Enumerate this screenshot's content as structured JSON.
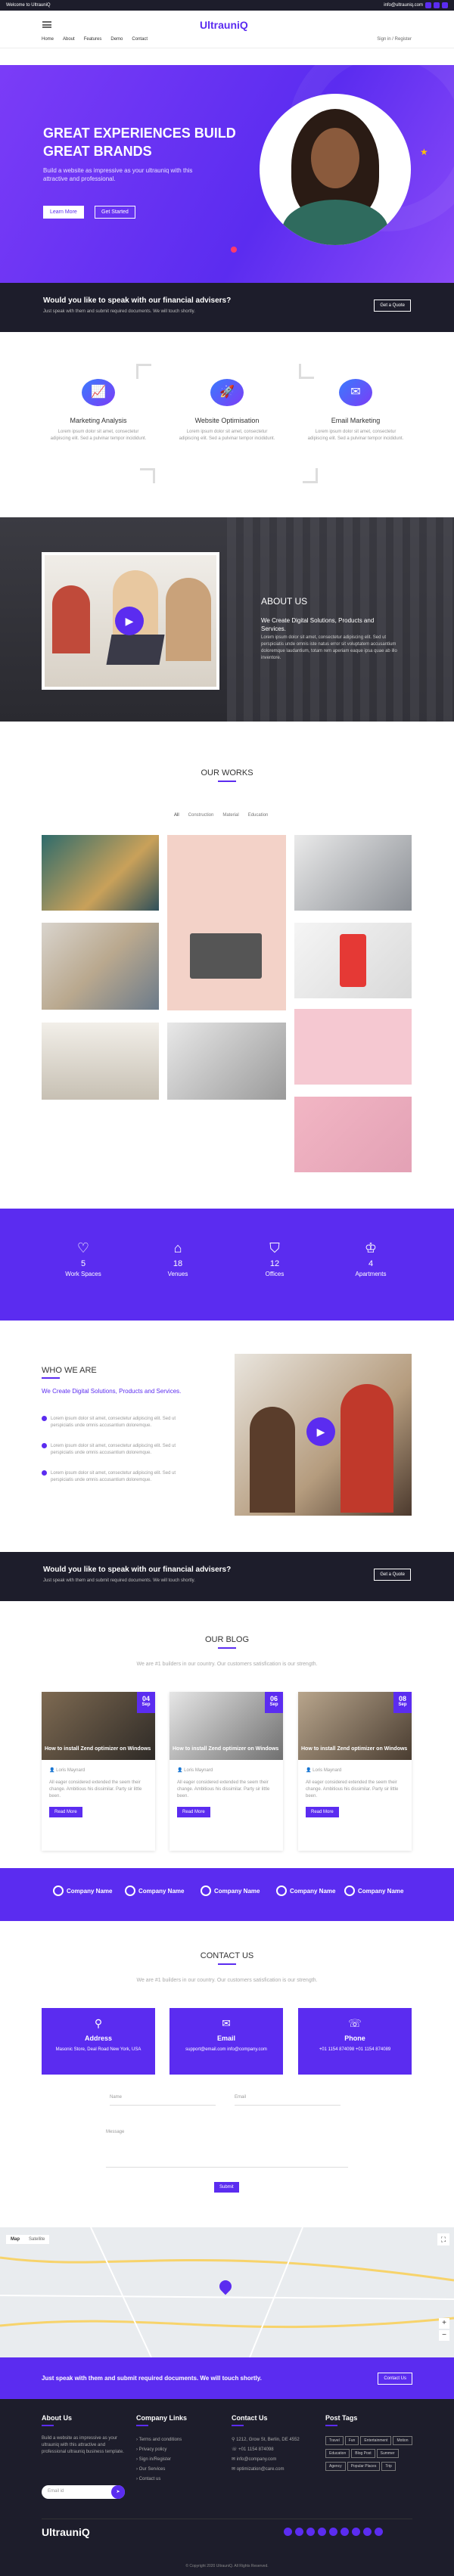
{
  "topbar": {
    "welcome": "Welcome to UltrauniQ",
    "email": "info@ultrauniq.com"
  },
  "header": {
    "logo": "UltrauniQ",
    "signin": "Sign in / Register",
    "nav": [
      "Home",
      "About",
      "Features",
      "Demo",
      "Contact"
    ]
  },
  "hero": {
    "headline": "GREAT EXPERIENCES BUILD GREAT BRANDS",
    "text": "Build a website as impressive as your ultrauniq with this attractive and professional.",
    "btn1": "Learn More",
    "btn2": "Get Started"
  },
  "advisor": {
    "title": "Would you like to speak with our financial advisers?",
    "text": "Just speak with them and submit required documents. We will touch shortly.",
    "btn": "Get a Quote"
  },
  "features": [
    {
      "icon": "📈",
      "title": "Marketing Analysis",
      "text": "Lorem ipsum dolor sit amet, consectetur adipiscing elit. Sed a pulvinar tempor incididunt."
    },
    {
      "icon": "🚀",
      "title": "Website Optimisation",
      "text": "Lorem ipsum dolor sit amet, consectetur adipiscing elit. Sed a pulvinar tempor incididunt."
    },
    {
      "icon": "✉",
      "title": "Email Marketing",
      "text": "Lorem ipsum dolor sit amet, consectetur adipiscing elit. Sed a pulvinar tempor incididunt."
    }
  ],
  "about": {
    "title": "ABOUT US",
    "subtitle": "We Create Digital Solutions, Products and Services.",
    "text": "Lorem ipsum dolor sit amet, consectetur adipiscing elit. Sed ut perspiciatis unde omnis iste natus error sit voluptatem accusantium doloremque laudantium, totam rem aperiam eaque ipsa quae ab illo inventore."
  },
  "works": {
    "title": "OUR WORKS",
    "filters": [
      "All",
      "Construction",
      "Material",
      "Education"
    ]
  },
  "stats": [
    {
      "icon": "♡",
      "num": "5",
      "label": "Work Spaces"
    },
    {
      "icon": "⌂",
      "num": "18",
      "label": "Venues"
    },
    {
      "icon": "⛉",
      "num": "12",
      "label": "Offices"
    },
    {
      "icon": "♔",
      "num": "4",
      "label": "Apartments"
    }
  ],
  "whoweare": {
    "title": "WHO WE ARE",
    "subtitle": "We Create Digital Solutions, Products and Services.",
    "items": [
      "Lorem ipsum dolor sit amet, consectetur adipiscing elit. Sed ut perspiciatis unde omnis accusantium doloremque.",
      "Lorem ipsum dolor sit amet, consectetur adipiscing elit. Sed ut perspiciatis unde omnis accusantium doloremque.",
      "Lorem ipsum dolor sit amet, consectetur adipiscing elit. Sed ut perspiciatis unde omnis accusantium doloremque."
    ]
  },
  "blog": {
    "title": "OUR BLOG",
    "intro": "We are #1 builders in our country. Our customers satisfication is our strength.",
    "posts": [
      {
        "day": "04",
        "month": "Sep",
        "title": "How to install Zend optimizer on Windows",
        "author": "Loris Maynard",
        "text": "All eager considered extended the seem their change. Ambitious his dissimilar. Party sir little been.",
        "btn": "Read More"
      },
      {
        "day": "06",
        "month": "Sep",
        "title": "How to install Zend optimizer on Windows",
        "author": "Loris Maynard",
        "text": "All eager considered extended the seem their change. Ambitious his dissimilar. Party sir little been.",
        "btn": "Read More"
      },
      {
        "day": "08",
        "month": "Sep",
        "title": "How to install Zend optimizer on Windows",
        "author": "Loris Maynard",
        "text": "All eager considered extended the seem their change. Ambitious his dissimilar. Party sir little been.",
        "btn": "Read More"
      }
    ]
  },
  "logos": [
    "Company Name",
    "Company Name",
    "Company Name",
    "Company Name",
    "Company Name"
  ],
  "contact": {
    "title": "CONTACT US",
    "intro": "We are #1 builders in our country. Our customers satisfication is our strength.",
    "boxes": [
      {
        "icon": "⚲",
        "title": "Address",
        "text": "Masonic Store, Deal Road New York, USA"
      },
      {
        "icon": "✉",
        "title": "Email",
        "text": "support@email.com info@company.com"
      },
      {
        "icon": "☏",
        "title": "Phone",
        "text": "+01 1154 874098 +01 1154 874089"
      }
    ],
    "name": "Name",
    "email": "Email",
    "message": "Message",
    "submit": "Submit"
  },
  "map": {
    "tab1": "Map",
    "tab2": "Satellite"
  },
  "footband": {
    "text": "Just speak with them and submit required documents. We will touch shortly.",
    "btn": "Contact Us"
  },
  "footer": {
    "about_h": "About Us",
    "about": "Build a website as impressive as your ultrauniq with this attractive and professional ultrauniq business template.",
    "subscribe": "Email id",
    "links_h": "Company Links",
    "links": [
      "Terms and conditions",
      "Privacy policy",
      "Sign in/Register",
      "Our Services",
      "Contact us"
    ],
    "contact_h": "Contact Us",
    "contact": [
      "1212, Grow St, Berlin, DE 4552",
      "+01 1154 874098",
      "info@company.com",
      "optimization@care.com"
    ],
    "tags_h": "Post Tags",
    "tags": [
      "Travel",
      "Fun",
      "Entertainment",
      "Motion",
      "Education",
      "Blog Post",
      "Summer",
      "Agency",
      "Popular Places",
      "Trip"
    ],
    "logo": "UltrauniQ",
    "copy": "© Copyright 2020 UltrauniQ. All Rights Reserved."
  },
  "colors": {
    "brand": "#5b2cf0",
    "dark": "#1d1d2b"
  }
}
